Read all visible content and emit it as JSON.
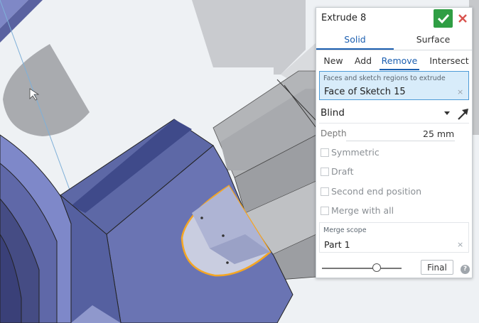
{
  "dialog": {
    "title": "Extrude 8",
    "ok_icon": "checkmark-icon",
    "close_icon": "close-icon",
    "body_types": [
      "Solid",
      "Surface"
    ],
    "active_body_type": "Solid",
    "operations": [
      "New",
      "Add",
      "Remove",
      "Intersect"
    ],
    "active_operation": "Remove",
    "selection": {
      "label": "Faces and sketch regions to extrude",
      "value": "Face of Sketch 15",
      "clear": "×"
    },
    "end_type": "Blind",
    "flip_icon": "flip-direction-arrow-icon",
    "depth": {
      "label": "Depth",
      "value": "25 mm"
    },
    "options": [
      {
        "label": "Symmetric",
        "checked": false
      },
      {
        "label": "Draft",
        "checked": false
      },
      {
        "label": "Second end position",
        "checked": false
      },
      {
        "label": "Merge with all",
        "checked": false
      }
    ],
    "merge_scope": {
      "label": "Merge scope",
      "value": "Part 1",
      "clear": "×"
    },
    "rollback_slider": 0.68,
    "final_label": "Final",
    "help_label": "?"
  },
  "colors": {
    "accent": "#1c5fb0",
    "ok_green": "#2f9e44",
    "close_red": "#d9534f",
    "selection_highlight": "#f5a623",
    "part_blue": "#6f79b5"
  }
}
